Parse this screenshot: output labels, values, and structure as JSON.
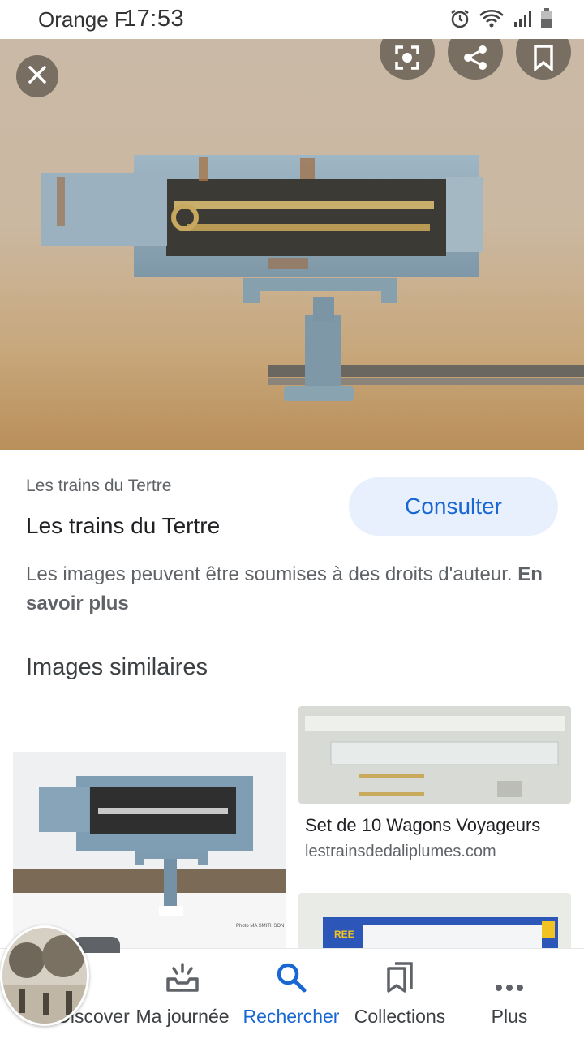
{
  "status_bar": {
    "carrier": "Orange F",
    "time": "17:53",
    "icons": [
      "alarm-icon",
      "wifi-icon",
      "signal-icon",
      "battery-icon"
    ]
  },
  "viewer": {
    "actions": [
      "close-icon",
      "lens-icon",
      "share-icon",
      "bookmark-icon"
    ]
  },
  "source": {
    "site": "Les trains du Tertre",
    "title": "Les trains du Tertre",
    "consult_label": "Consulter",
    "rights_text": "Les images peuvent être soumises à des droits d'auteur. ",
    "learn_more": "En savoir plus"
  },
  "similar": {
    "heading": "Images similaires",
    "items": [
      {
        "title": "",
        "site": "",
        "image_text": "Photo MA SMITHSON"
      },
      {
        "title": "Set de 10 Wagons Voyageurs",
        "site": "lestrainsdedaliplumes.com"
      },
      {
        "title": "",
        "site": "",
        "image_text": "REE"
      }
    ]
  },
  "nav": {
    "items": [
      {
        "label": "Discover",
        "icon": "asterisk-icon"
      },
      {
        "label": "Ma journée",
        "icon": "inbox-icon"
      },
      {
        "label": "Rechercher",
        "icon": "search-icon"
      },
      {
        "label": "Collections",
        "icon": "collections-icon"
      },
      {
        "label": "Plus",
        "icon": "more-icon"
      }
    ],
    "active_index": 2,
    "active_color": "#1967d2"
  }
}
